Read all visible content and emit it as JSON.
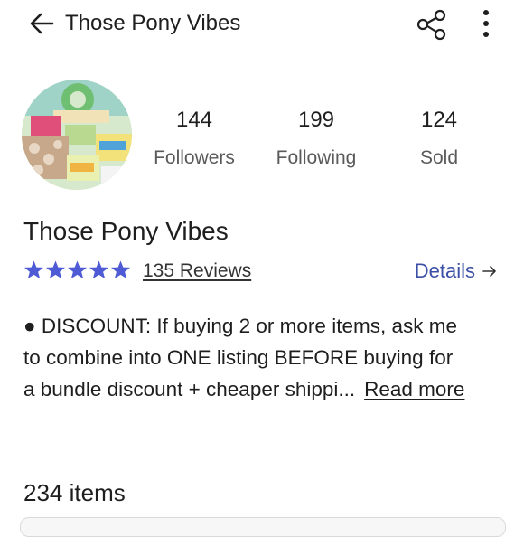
{
  "header": {
    "title": "Those Pony Vibes",
    "back_icon": "arrow-left-icon",
    "share_icon": "share-icon",
    "more_icon": "more-vertical-icon"
  },
  "profile": {
    "avatar_icon": "closet-avatar-photo",
    "stats": [
      {
        "value": "144",
        "label": "Followers"
      },
      {
        "value": "199",
        "label": "Following"
      },
      {
        "value": "124",
        "label": "Sold"
      }
    ],
    "name": "Those Pony Vibes",
    "rating_stars": 5,
    "reviews_label": "135 Reviews",
    "details_label": "Details",
    "star_color": "#4f5bd5",
    "link_color": "#3b4fa6"
  },
  "bio": {
    "lines": [
      "● DISCOUNT: If buying 2 or more items, ask me",
      "to combine into ONE listing BEFORE buying for",
      "a bundle discount + cheaper shippi..."
    ],
    "read_more": "Read more"
  },
  "listings": {
    "count_label": "234 items"
  }
}
